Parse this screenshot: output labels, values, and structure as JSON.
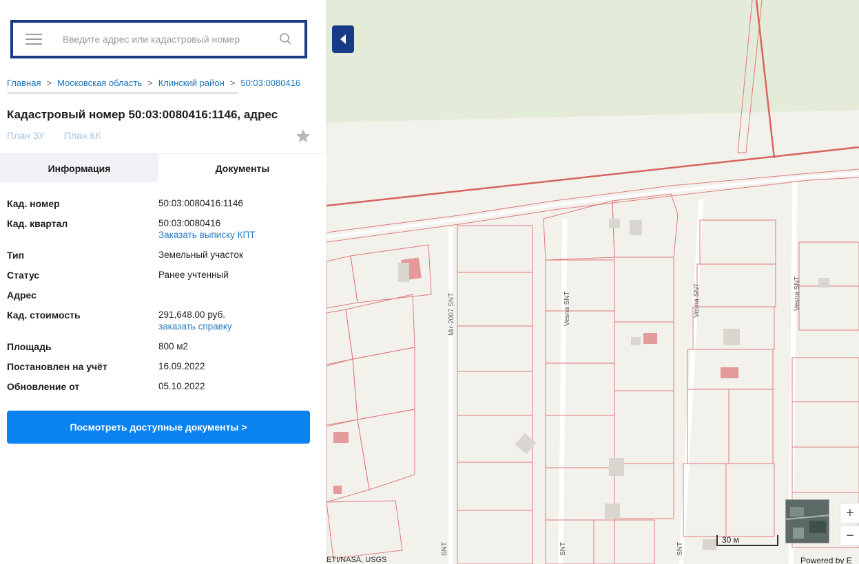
{
  "search": {
    "placeholder": "Введите адрес или кадастровый номер"
  },
  "breadcrumb": [
    {
      "label": "Главная"
    },
    {
      "label": "Московская область"
    },
    {
      "label": "Клинский район"
    },
    {
      "label": "50:03:0080416"
    }
  ],
  "breadcrumb_sep": ">",
  "title": "Кадастровый номер 50:03:0080416:1146, адрес",
  "plan_links": {
    "plan_zu": "План ЗУ",
    "plan_kk": "План КК"
  },
  "tabs": {
    "info": "Информация",
    "docs": "Документы"
  },
  "info": {
    "cad_number_label": "Кад. номер",
    "cad_number_value": "50:03:0080416:1146",
    "cad_block_label": "Кад. квартал",
    "cad_block_value": "50:03:0080416",
    "cad_block_link": "Заказать выписку КПТ",
    "type_label": "Тип",
    "type_value": "Земельный участок",
    "status_label": "Статус",
    "status_value": "Ранее учтенный",
    "address_label": "Адрес",
    "cost_label": "Кад. стоимость",
    "cost_value": "291,648.00 руб.",
    "cost_link": "заказать справку",
    "area_label": "Площадь",
    "area_value": "800 м2",
    "registered_label": "Постановлен на учёт",
    "registered_value": "16.09.2022",
    "updated_label": "Обновление от",
    "updated_value": "05.10.2022"
  },
  "cta_label": "Посмотреть доступные документы >",
  "map": {
    "street_labels": [
      "Mir-2007 SNT",
      "Vesna SNT",
      "Vesna SNT",
      "Vesna SNT",
      "SNT",
      "SNT",
      "SNT"
    ],
    "scale_label": "30 м",
    "zoom_in": "+",
    "zoom_out": "−",
    "attribution": "ETI/NASA, USGS",
    "powered_by": "Powered by E"
  },
  "colors": {
    "search_border": "#173b87",
    "cta": "#0a82f0",
    "link": "#1a74b8",
    "parcel_line": "#e07b7b"
  }
}
